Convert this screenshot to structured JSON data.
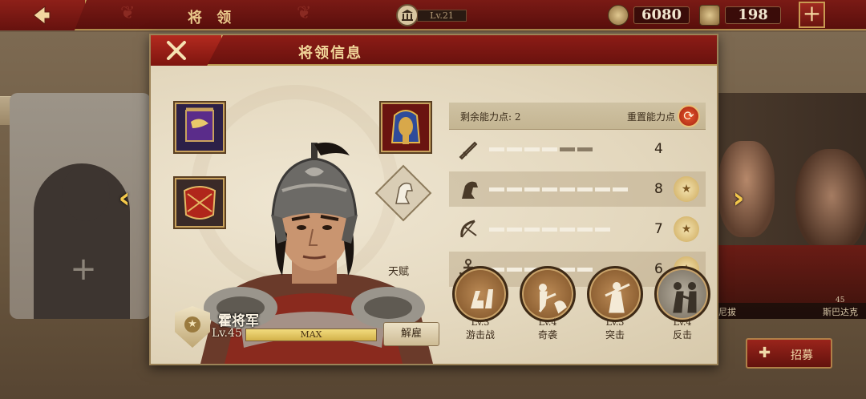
{
  "topbar": {
    "title": "将 领",
    "player_level": "Lv.21",
    "coins": "6080",
    "gems": "198"
  },
  "modal": {
    "title": "将领信息",
    "talent_label": "天赋",
    "hero": {
      "name": "霍将军",
      "level": "Lv.45",
      "exp_text": "MAX",
      "exp_fraction": 1.0,
      "dismiss_label": "解雇"
    },
    "points": {
      "label": "剩余能力点: 2",
      "reset_label": "重置能力点"
    },
    "stats": [
      {
        "icon": "sword-icon",
        "value": "4",
        "filled": 4,
        "total": 6,
        "medal": false
      },
      {
        "icon": "horse-icon",
        "value": "8",
        "filled": 8,
        "total": 8,
        "medal": true
      },
      {
        "icon": "bow-icon",
        "value": "7",
        "filled": 7,
        "total": 7,
        "medal": true
      },
      {
        "icon": "anchor-icon",
        "value": "6",
        "filled": 6,
        "total": 6,
        "medal": true
      }
    ],
    "skills": [
      {
        "level": "Lv.3",
        "name": "游击战",
        "icon": "cavalry-skill-icon"
      },
      {
        "level": "Lv.4",
        "name": "奇袭",
        "icon": "ambush-skill-icon"
      },
      {
        "level": "Lv.3",
        "name": "突击",
        "icon": "charge-skill-icon"
      },
      {
        "level": "Lv.4",
        "name": "反击",
        "icon": "counter-skill-icon"
      }
    ]
  },
  "side": {
    "right_names": [
      "尼拔",
      "斯巴达克"
    ],
    "right_level": "45",
    "recruit_label": "招募"
  },
  "colors": {
    "accent_red": "#7a1a15",
    "gold": "#c9a25a",
    "stat_filled": "#f4eee0",
    "stat_empty": "#8a7c66"
  }
}
